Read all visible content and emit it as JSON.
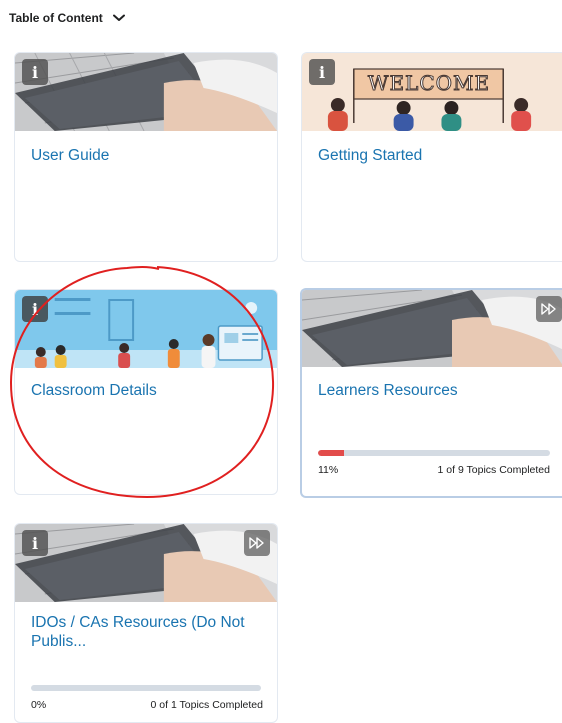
{
  "toc": {
    "label": "Table of Content"
  },
  "cards": {
    "user_guide": {
      "title": "User Guide"
    },
    "getting_started": {
      "title": "Getting Started",
      "banner_text": "WELCOME"
    },
    "classroom_details": {
      "title": "Classroom Details"
    },
    "learners_resources": {
      "title": "Learners Resources",
      "progress": {
        "percent_label": "11%",
        "completed_label": "1 of 9 Topics Completed",
        "fraction": 0.11
      }
    },
    "idos_resources": {
      "title": "IDOs / CAs Resources (Do Not Publis...",
      "progress": {
        "percent_label": "0%",
        "completed_label": "0 of 1 Topics Completed",
        "fraction": 0.0
      }
    }
  },
  "colors": {
    "title_link": "#1a74b0",
    "progress_fill": "#e24c4b",
    "progress_track": "#d4dbe3",
    "annotation_circle": "#e02020"
  },
  "icons": [
    "chevron-down-icon",
    "info-icon",
    "fast-forward-icon"
  ]
}
